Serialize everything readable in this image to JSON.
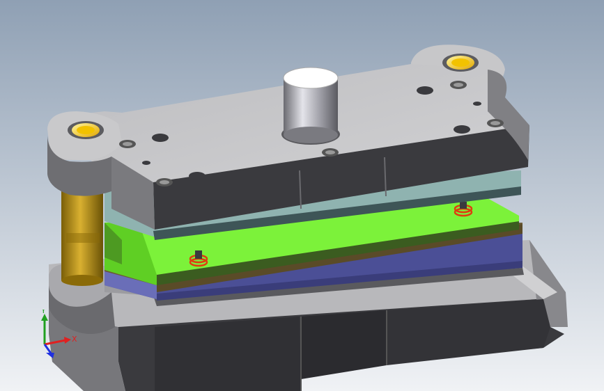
{
  "viewport": {
    "background_top": "#8fa0b4",
    "background_bottom": "#f0f2f5"
  },
  "triad": {
    "x_label": "X",
    "y_label": "Y",
    "z_label": "",
    "x_color": "#e02020",
    "y_color": "#20a020",
    "z_color": "#2030e0"
  },
  "model": {
    "colors": {
      "plate_dark": "#4c4c50",
      "plate_top": "#c7c7c9",
      "plate_light": "#8e8e92",
      "guide_post": "#c9a020",
      "bushing": "#f2c200",
      "teal_plate": "#8fb3b0",
      "teal_plate_side": "#3e5557",
      "green_plate": "#7cf23a",
      "green_plate_side": "#3b5c20",
      "brown_plate": "#6b5a34",
      "blue_plate": "#4b4f96",
      "blue_plate_top": "#7a7ec8",
      "spring": "#e03c10",
      "punch_head": "#ffffff"
    }
  }
}
